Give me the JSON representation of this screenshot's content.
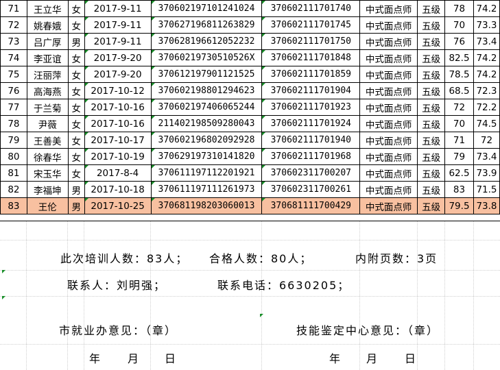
{
  "rows": [
    {
      "no": "71",
      "name": "王立华",
      "sex": "女",
      "date": "2017-9-11",
      "id": "370602197101241024",
      "cert": "370602111701740",
      "job": "中式面点师",
      "level": "五级",
      "score": "78",
      "total": "74.2"
    },
    {
      "no": "72",
      "name": "姚春娥",
      "sex": "女",
      "date": "2017-9-11",
      "id": "370627196811263829",
      "cert": "370602111701745",
      "job": "中式面点师",
      "level": "五级",
      "score": "70",
      "total": "73.3"
    },
    {
      "no": "73",
      "name": "吕广厚",
      "sex": "男",
      "date": "2017-9-11",
      "id": "370628196612052232",
      "cert": "370602111701750",
      "job": "中式面点师",
      "level": "五级",
      "score": "76",
      "total": "73.4"
    },
    {
      "no": "74",
      "name": "李亚谊",
      "sex": "女",
      "date": "2017-9-20",
      "id": "37060219730510526X",
      "cert": "370602111701848",
      "job": "中式面点师",
      "level": "五级",
      "score": "82.5",
      "total": "74.2"
    },
    {
      "no": "75",
      "name": "汪丽萍",
      "sex": "女",
      "date": "2017-9-20",
      "id": "370612197901121525",
      "cert": "370602111701859",
      "job": "中式面点师",
      "level": "五级",
      "score": "78.5",
      "total": "74.2"
    },
    {
      "no": "76",
      "name": "高海燕",
      "sex": "女",
      "date": "2017-10-12",
      "id": "370602198801294623",
      "cert": "370602111701904",
      "job": "中式面点师",
      "level": "五级",
      "score": "68.5",
      "total": "72.3"
    },
    {
      "no": "77",
      "name": "于兰菊",
      "sex": "女",
      "date": "2017-10-16",
      "id": "370602197406065244",
      "cert": "370602111701923",
      "job": "中式面点师",
      "level": "五级",
      "score": "72",
      "total": "72.2"
    },
    {
      "no": "78",
      "name": "尹薇",
      "sex": "女",
      "date": "2017-10-16",
      "id": "211402198509280043",
      "cert": "370602111701924",
      "job": "中式面点师",
      "level": "五级",
      "score": "70",
      "total": "74.5"
    },
    {
      "no": "79",
      "name": "王善美",
      "sex": "女",
      "date": "2017-10-17",
      "id": "370602196802092928",
      "cert": "370602111701940",
      "job": "中式面点师",
      "level": "五级",
      "score": "71",
      "total": "72"
    },
    {
      "no": "80",
      "name": "徐春华",
      "sex": "女",
      "date": "2017-10-19",
      "id": "370629197310141820",
      "cert": "370602111701968",
      "job": "中式面点师",
      "level": "五级",
      "score": "79",
      "total": "73.4"
    },
    {
      "no": "81",
      "name": "宋玉华",
      "sex": "女",
      "date": "2017-8-4",
      "id": "370611197112201921",
      "cert": "370602311700207",
      "job": "中式面点师",
      "level": "五级",
      "score": "62.5",
      "total": "73.9"
    },
    {
      "no": "82",
      "name": "李福坤",
      "sex": "男",
      "date": "2017-10-18",
      "id": "370611197111261973",
      "cert": "370602311700261",
      "job": "中式面点师",
      "level": "五级",
      "score": "83",
      "total": "71.5"
    },
    {
      "no": "83",
      "name": "王伦",
      "sex": "男",
      "date": "2017-10-25",
      "id": "370681198203060013",
      "cert": "370681111700429",
      "job": "中式面点师",
      "level": "五级",
      "score": "79.5",
      "total": "73.8"
    }
  ],
  "summary": {
    "line1_trainees": "此次培训人数：83人；",
    "line1_passed": "合格人数：80人；",
    "line1_pages": "内附页数：3页",
    "line2_contact": "联系人：刘明强；",
    "line2_phone": "联系电话：6630205；"
  },
  "signatures": {
    "left_label": "市就业办意见：（章）",
    "right_label": "技能鉴定中心意见：（章）",
    "date_year": "年",
    "date_month": "月",
    "date_day": "日"
  },
  "colors": {
    "highlight_row": "#f8c0a0",
    "error_marker": "#1a8f2a"
  }
}
